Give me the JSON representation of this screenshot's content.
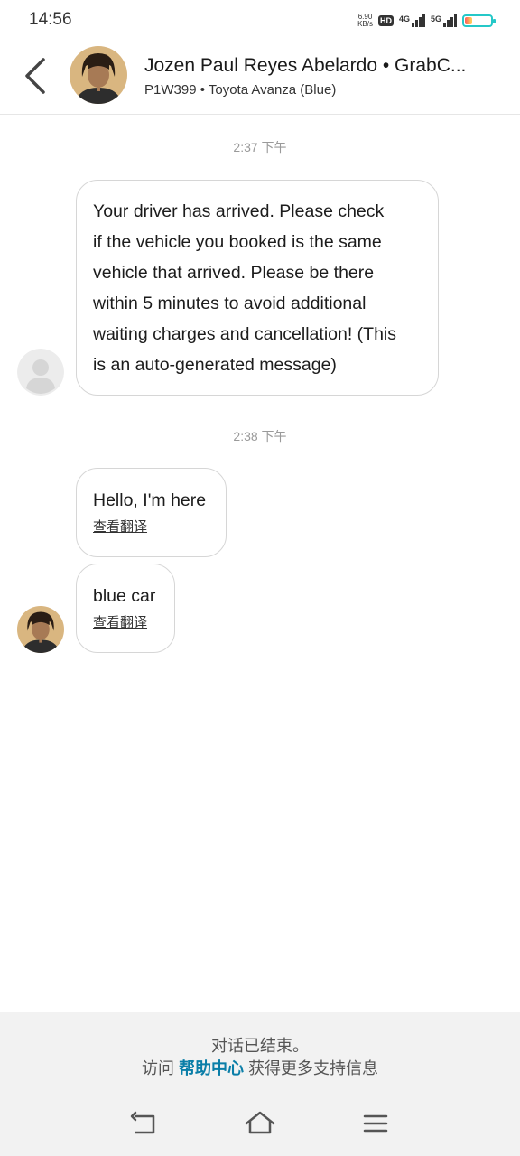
{
  "status_bar": {
    "time": "14:56",
    "net_speed_value": "6.90",
    "net_speed_unit": "KB/s",
    "hd": "HD",
    "sim1_label": "4G",
    "sim2_label": "5G",
    "battery_level": 0.3
  },
  "header": {
    "driver_name": "Jozen Paul Reyes Abelardo • GrabC...",
    "vehicle_info": "P1W399 • Toyota Avanza (Blue)"
  },
  "messages": [
    {
      "timestamp": "2:37 下午",
      "text_lines": [
        "Your driver has arrived. Please check",
        "if the vehicle you booked is the same",
        "vehicle that arrived. Please be there",
        "within 5 minutes to avoid additional",
        "waiting charges and cancellation! (This",
        "is an auto-generated message)"
      ]
    },
    {
      "timestamp": "2:38 下午",
      "text": "Hello, I'm here",
      "translate": "查看翻译"
    },
    {
      "text": "blue car",
      "translate": "查看翻译"
    }
  ],
  "footer": {
    "ended": "对话已结束。",
    "help_prefix": "访问",
    "help_link": "帮助中心",
    "help_suffix": "获得更多支持信息"
  },
  "colors": {
    "link": "#0a7ea8",
    "battery_outline": "#25c8c8"
  }
}
